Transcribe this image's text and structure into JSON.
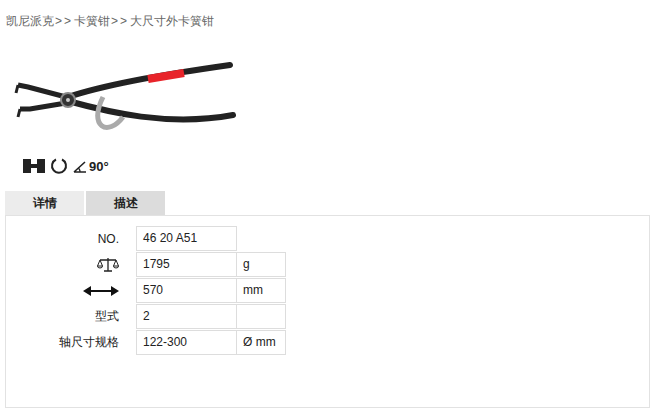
{
  "breadcrumb": {
    "items": [
      "凯尼派克",
      "卡簧钳",
      "大尺寸外卡簧钳"
    ],
    "separator": ">>"
  },
  "product": {
    "angle": "90°"
  },
  "tabs": [
    {
      "label": "详情",
      "selected": true
    },
    {
      "label": "描述",
      "selected": false
    }
  ],
  "specs": [
    {
      "kind": "text",
      "label": "NO.",
      "value": "46 20 A51"
    },
    {
      "kind": "weight",
      "label": "",
      "value": "1795",
      "unit": "g"
    },
    {
      "kind": "length",
      "label": "",
      "value": "570",
      "unit": "mm"
    },
    {
      "kind": "text",
      "label": "型式",
      "value": "2",
      "unit": ""
    },
    {
      "kind": "text",
      "label": "轴尺寸规格",
      "value": "122-300",
      "unit": "Ø mm"
    }
  ]
}
